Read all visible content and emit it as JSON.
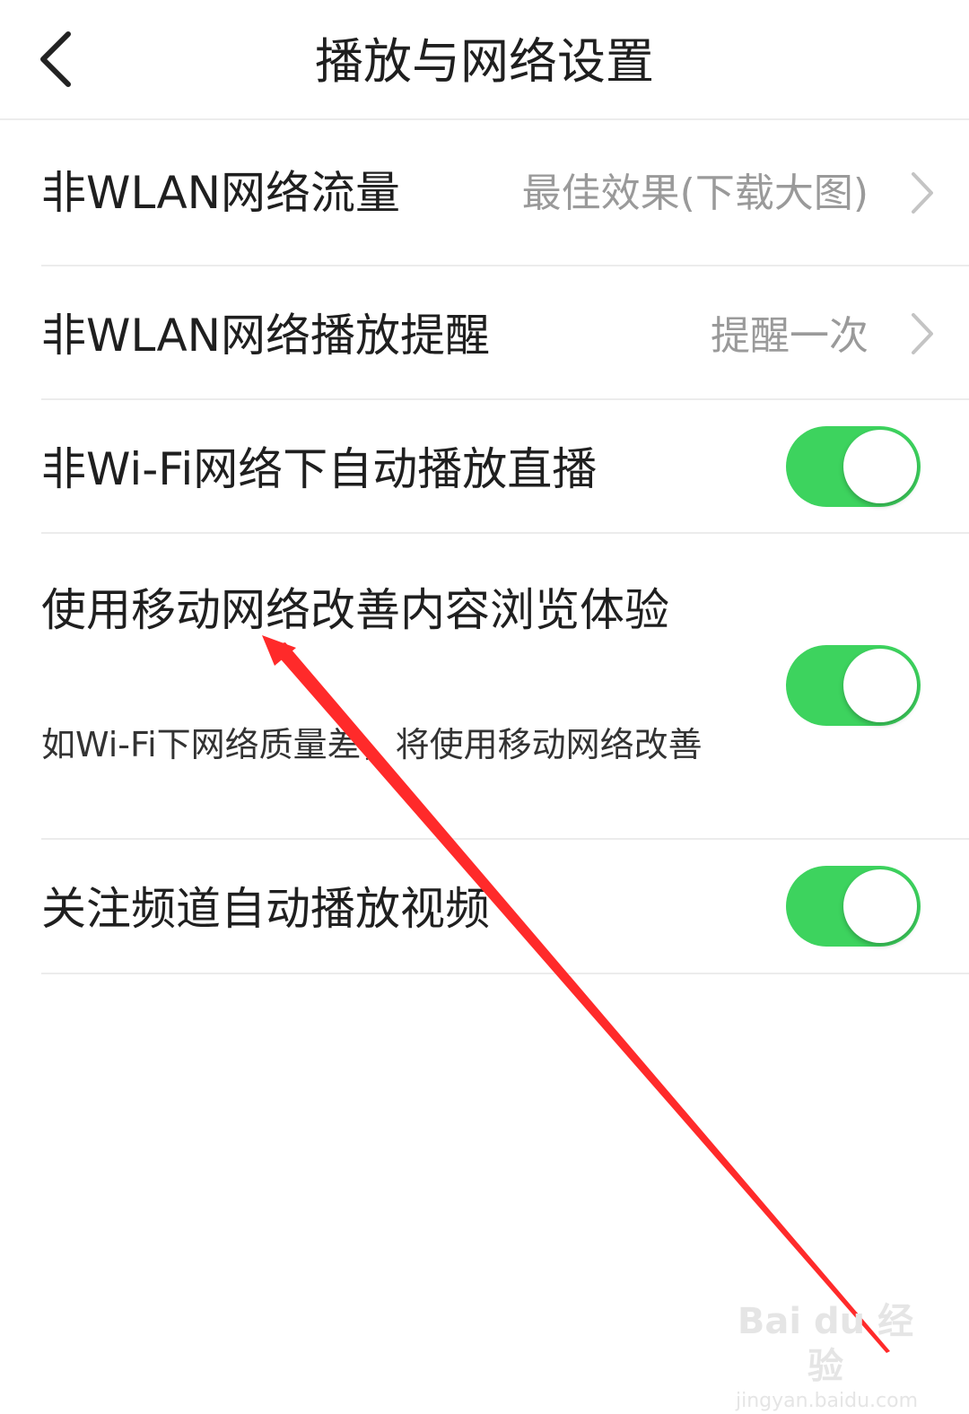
{
  "header": {
    "title": "播放与网络设置"
  },
  "rows": [
    {
      "label": "非WLAN网络流量",
      "value": "最佳效果(下载大图)"
    },
    {
      "label": "非WLAN网络播放提醒",
      "value": "提醒一次"
    },
    {
      "label": "非Wi-Fi网络下自动播放直播",
      "on": true
    },
    {
      "label": "使用移动网络改善内容浏览体验",
      "desc": "如Wi-Fi下网络质量差，将使用移动网络改善",
      "on": true
    },
    {
      "label": "关注频道自动播放视频",
      "on": true
    }
  ],
  "watermark": {
    "logo": "Bai du 经验",
    "url": "jingyan.baidu.com"
  },
  "colors": {
    "toggle_on": "#3dd35e",
    "annotation": "#ff2a2a",
    "secondary_text": "#9a9a9a"
  },
  "icons": {
    "back": "chevron-left-icon",
    "disclosure": "chevron-right-icon",
    "annotation": "red-arrow"
  }
}
